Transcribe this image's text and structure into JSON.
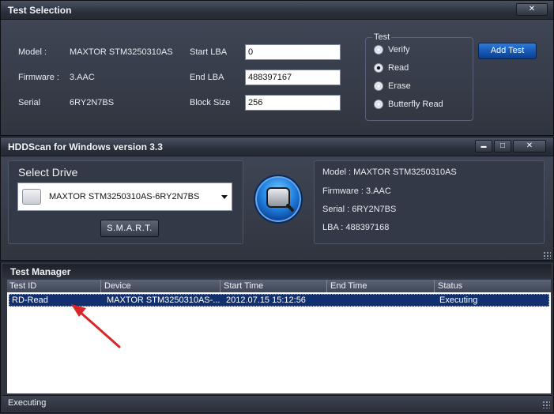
{
  "test_selection": {
    "title": "Test Selection",
    "close_glyph": "✕",
    "model_label": "Model :",
    "model_value": "MAXTOR STM3250310AS",
    "firmware_label": "Firmware :",
    "firmware_value": "3.AAC",
    "serial_label": "Serial",
    "serial_value": "6RY2N7BS",
    "start_lba_label": "Start LBA",
    "start_lba_value": "0",
    "end_lba_label": "End LBA",
    "end_lba_value": "488397167",
    "block_size_label": "Block Size",
    "block_size_value": "256",
    "test_group_title": "Test",
    "options": [
      {
        "label": "Verify",
        "selected": false
      },
      {
        "label": "Read",
        "selected": true
      },
      {
        "label": "Erase",
        "selected": false
      },
      {
        "label": "Butterfly Read",
        "selected": false
      }
    ],
    "add_test_label": "Add Test"
  },
  "main_window": {
    "title": "HDDScan for Windows version 3.3",
    "minimize_glyph": "▬",
    "maximize_glyph": "□",
    "close_glyph": "✕",
    "select_drive_label": "Select Drive",
    "drive_selected": "MAXTOR STM3250310AS-6RY2N7BS",
    "smart_label": "S.M.A.R.T.",
    "info_model": "Model : MAXTOR STM3250310AS",
    "info_firmware": "Firmware : 3.AAC",
    "info_serial": "Serial : 6RY2N7BS",
    "info_lba": "LBA : 488397168"
  },
  "test_manager": {
    "title": "Test Manager",
    "columns": [
      "Test ID",
      "Device",
      "Start Time",
      "End Time",
      "Status"
    ],
    "rows": [
      {
        "test_id": "RD-Read",
        "device": "MAXTOR STM3250310AS-...",
        "start_time": "2012.07.15 15:12:56",
        "end_time": "",
        "status": "Executing"
      }
    ],
    "status_bar": "Executing"
  },
  "colors": {
    "accent": "#1557b4",
    "selected_row": "#13306e",
    "annotation_arrow": "#d8262b"
  },
  "icons": {
    "drive_icon": "hard-drive-icon",
    "scan_button_icon": "magnifier-drive-icon",
    "dropdown": "chevron-down-icon"
  }
}
